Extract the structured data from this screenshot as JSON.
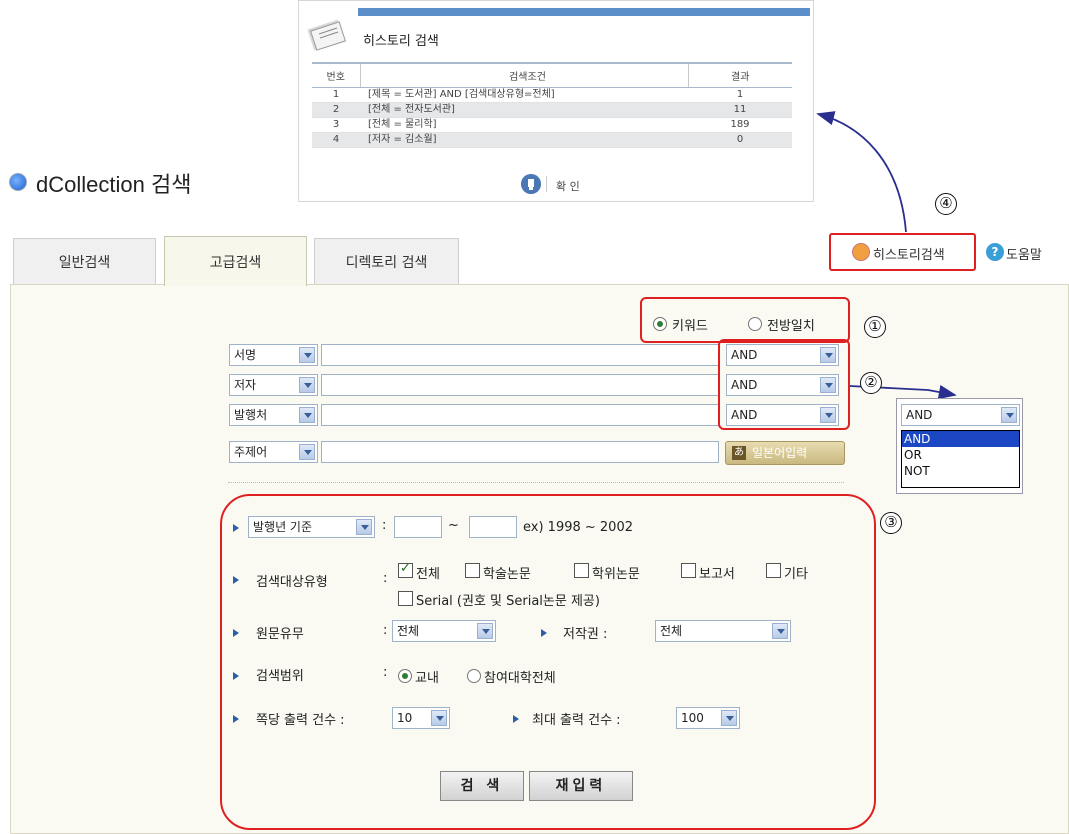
{
  "history_popup": {
    "title": "히스토리 검색",
    "columns": [
      "번호",
      "검색조건",
      "결과"
    ],
    "rows": [
      {
        "no": "1",
        "condition": "[제목 = 도서관] AND [검색대상유형=전체]",
        "result": "1"
      },
      {
        "no": "2",
        "condition": "[전체 = 전자도서관]",
        "result": "11"
      },
      {
        "no": "3",
        "condition": "[전체 = 물리학]",
        "result": "189"
      },
      {
        "no": "4",
        "condition": "[저자 = 김소월]",
        "result": "0"
      }
    ],
    "ok_label": "확 인"
  },
  "page_title": "dCollection 검색",
  "tabs": [
    "일반검색",
    "고급검색",
    "디렉토리 검색"
  ],
  "top_links": {
    "history": "히스토리검색",
    "help": "도움말",
    "help_glyph": "?"
  },
  "callouts": [
    "①",
    "②",
    "③",
    "④"
  ],
  "match_mode": {
    "keyword": "키워드",
    "prefix": "전방일치",
    "selected": "keyword"
  },
  "search_rows": [
    {
      "field": "서명",
      "value": "",
      "operator": "AND"
    },
    {
      "field": "저자",
      "value": "",
      "operator": "AND"
    },
    {
      "field": "발행처",
      "value": "",
      "operator": "AND"
    },
    {
      "field": "주제어",
      "value": ""
    }
  ],
  "japanese_input": {
    "glyph": "あ",
    "label": "일본어입력"
  },
  "operator_dropdown": {
    "selected": "AND",
    "options": [
      "AND",
      "OR",
      "NOT"
    ]
  },
  "filters": {
    "year": {
      "select": "발행년 기준",
      "from": "",
      "to": "",
      "tilde": "~",
      "example": "ex) 1998 ~ 2002"
    },
    "doc_type": {
      "label": "검색대상유형",
      "options": [
        {
          "label": "전체",
          "checked": true
        },
        {
          "label": "학술논문",
          "checked": false
        },
        {
          "label": "학위논문",
          "checked": false
        },
        {
          "label": "보고서",
          "checked": false
        },
        {
          "label": "기타",
          "checked": false
        },
        {
          "label": "Serial (권호 및 Serial논문 제공)",
          "checked": false
        }
      ]
    },
    "fulltext": {
      "label": "원문유무",
      "value": "전체"
    },
    "copyright": {
      "label": "저작권 :",
      "value": "전체"
    },
    "scope": {
      "label": "검색범위",
      "options": [
        "교내",
        "참여대학전체"
      ],
      "selected": "교내"
    },
    "per_page": {
      "label": "쪽당 출력 건수 :",
      "value": "10"
    },
    "max_results": {
      "label": "최대 출력 건수 :",
      "value": "100"
    }
  },
  "buttons": {
    "search": "검 색",
    "reset": "재입력"
  },
  "colors": {
    "callout_red": "#e02020",
    "arrow_navy": "#2a2f8f",
    "highlight_blue": "#1c47c4"
  }
}
